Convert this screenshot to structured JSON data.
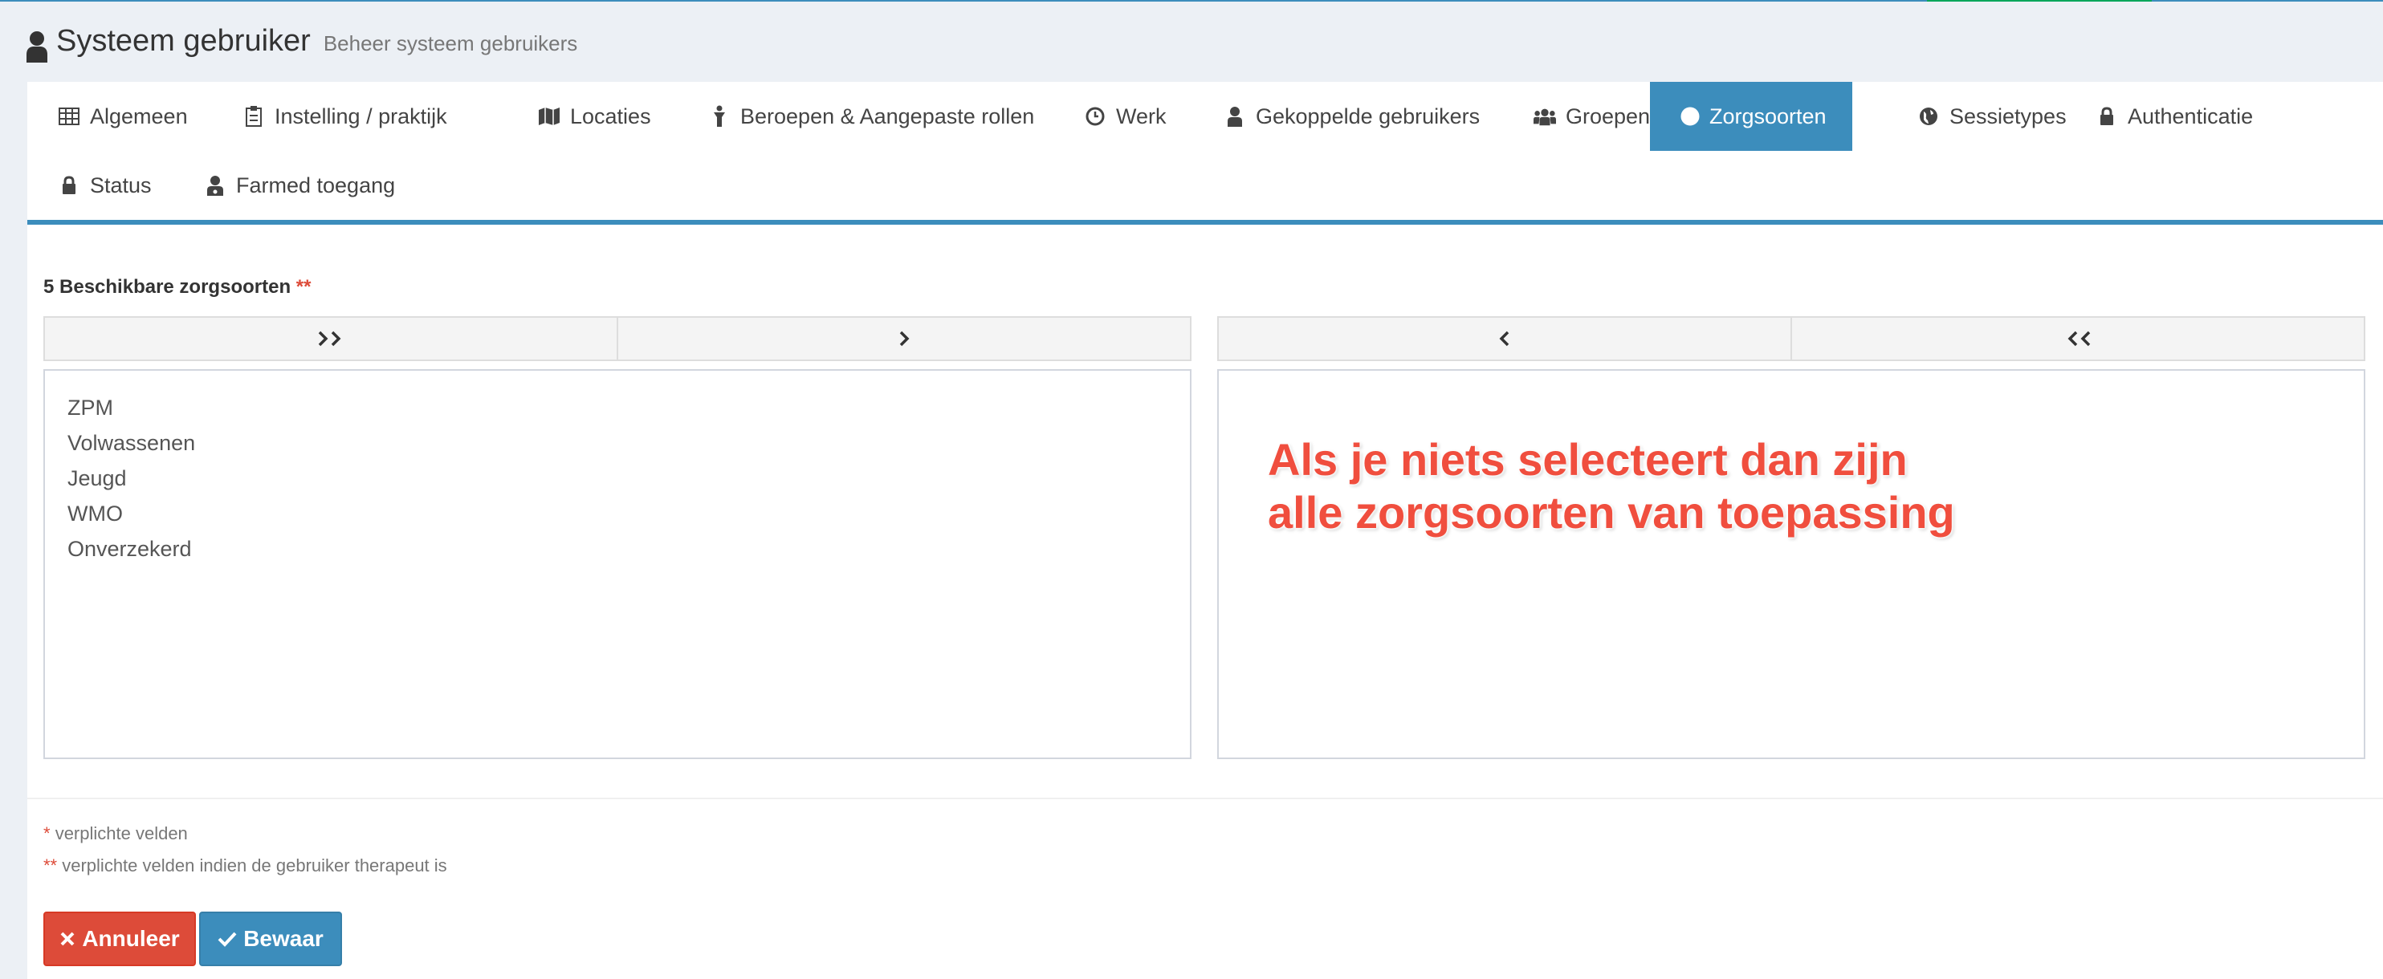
{
  "header": {
    "title": "Systeem gebruiker",
    "subtitle": "Beheer systeem gebruikers",
    "icon": "user-icon"
  },
  "tabs": [
    {
      "label": "Algemeen",
      "icon": "table-icon"
    },
    {
      "label": "Instelling / praktijk",
      "icon": "clipboard-icon"
    },
    {
      "label": "Locaties",
      "icon": "map-icon"
    },
    {
      "label": "Beroepen & Aangepaste rollen",
      "icon": "person-icon"
    },
    {
      "label": "Werk",
      "icon": "clock-icon"
    },
    {
      "label": "Gekoppelde gebruikers",
      "icon": "user-icon"
    },
    {
      "label": "Groepen",
      "icon": "users-icon"
    },
    {
      "label": "Zorgsoorten",
      "icon": "globe-icon",
      "active": true
    },
    {
      "label": "Sessietypes",
      "icon": "globe-icon"
    },
    {
      "label": "Authenticatie",
      "icon": "lock-icon"
    },
    {
      "label": "Status",
      "icon": "lock-icon"
    },
    {
      "label": "Farmed toegang",
      "icon": "user-md-icon"
    }
  ],
  "field": {
    "label": "5 Beschikbare zorgsoorten",
    "required_marker": "**"
  },
  "available_items": [
    "ZPM",
    "Volwassenen",
    "Jeugd",
    "WMO",
    "Onverzekerd"
  ],
  "annotation": {
    "line1": "Als je niets selecteert dan zijn",
    "line2": "alle zorgsoorten van toepassing"
  },
  "notes": {
    "required_marker": "*",
    "required_text": "verplichte velden",
    "therapist_marker": "**",
    "therapist_text": "verplichte velden indien de gebruiker therapeut is"
  },
  "buttons": {
    "cancel": "Annuleer",
    "save": "Bewaar"
  },
  "colors": {
    "primary": "#3c8dbc",
    "danger": "#dd4b39",
    "annotation": "#f04e3e"
  }
}
